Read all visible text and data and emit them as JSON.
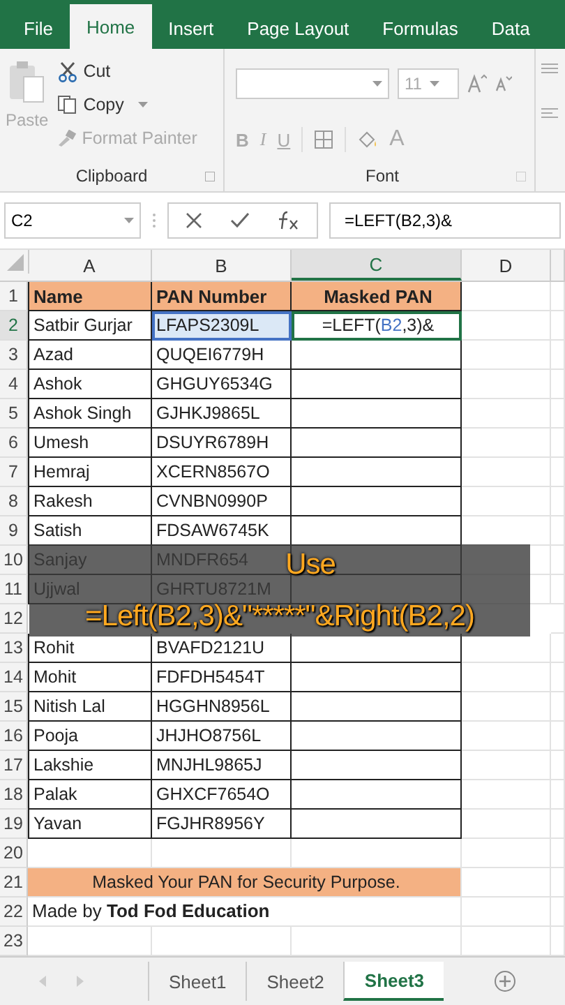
{
  "ribbon_tabs": [
    {
      "label": "File",
      "selected": false
    },
    {
      "label": "Home",
      "selected": true
    },
    {
      "label": "Insert",
      "selected": false
    },
    {
      "label": "Page Layout",
      "selected": false
    },
    {
      "label": "Formulas",
      "selected": false
    },
    {
      "label": "Data",
      "selected": false
    }
  ],
  "clipboard": {
    "paste": "Paste",
    "cut": "Cut",
    "copy": "Copy",
    "format_painter": "Format Painter",
    "group": "Clipboard"
  },
  "font": {
    "size": "11",
    "bold": "B",
    "italic": "I",
    "underline": "U",
    "font_color": "A",
    "group": "Font"
  },
  "formula_bar": {
    "name_box": "C2",
    "formula": "=LEFT(B2,3)&"
  },
  "columns": [
    "A",
    "B",
    "C",
    "D"
  ],
  "rows": [
    {
      "num": "1",
      "kind": "header",
      "cells": [
        "Name",
        "PAN Number",
        "Masked PAN"
      ]
    },
    {
      "num": "2",
      "kind": "data",
      "cells": [
        "Satbir Gurjar",
        "LFAPS2309L"
      ],
      "edit": {
        "before": "=LEFT(",
        "ref": "B2",
        "after": ",3)&"
      }
    },
    {
      "num": "3",
      "kind": "data",
      "cells": [
        "Azad",
        "QUQEI6779H"
      ]
    },
    {
      "num": "4",
      "kind": "data",
      "cells": [
        "Ashok",
        "GHGUY6534G"
      ]
    },
    {
      "num": "5",
      "kind": "data",
      "cells": [
        "Ashok Singh",
        "GJHKJ9865L"
      ]
    },
    {
      "num": "6",
      "kind": "data",
      "cells": [
        "Umesh",
        "DSUYR6789H"
      ]
    },
    {
      "num": "7",
      "kind": "data",
      "cells": [
        "Hemraj",
        "XCERN8567O"
      ]
    },
    {
      "num": "8",
      "kind": "data",
      "cells": [
        "Rakesh",
        "CVNBN0990P"
      ]
    },
    {
      "num": "9",
      "kind": "data",
      "cells": [
        "Satish",
        "FDSAW6745K"
      ]
    },
    {
      "num": "10",
      "kind": "data",
      "cells": [
        "Sanjay",
        "MNDFR654"
      ]
    },
    {
      "num": "11",
      "kind": "data",
      "cells": [
        "Ujjwal",
        "GHRTU8721M"
      ]
    },
    {
      "num": "12",
      "kind": "covered",
      "cells": []
    },
    {
      "num": "13",
      "kind": "data",
      "cells": [
        "Rohit",
        "BVAFD2121U"
      ]
    },
    {
      "num": "14",
      "kind": "data",
      "cells": [
        "Mohit",
        "FDFDH5454T"
      ]
    },
    {
      "num": "15",
      "kind": "data",
      "cells": [
        "Nitish Lal",
        "HGGHN8956L"
      ]
    },
    {
      "num": "16",
      "kind": "data",
      "cells": [
        "Pooja",
        "JHJHO8756L"
      ]
    },
    {
      "num": "17",
      "kind": "data",
      "cells": [
        "Lakshie",
        "MNJHL9865J"
      ]
    },
    {
      "num": "18",
      "kind": "data",
      "cells": [
        "Palak",
        "GHXCF7654O"
      ]
    },
    {
      "num": "19",
      "kind": "data",
      "cells": [
        "Yavan",
        "FGJHR8956Y"
      ]
    },
    {
      "num": "20",
      "kind": "blank",
      "cells": []
    },
    {
      "num": "21",
      "kind": "banner",
      "cells": [
        "Masked Your PAN for Security Purpose."
      ]
    },
    {
      "num": "22",
      "kind": "note",
      "cells": [
        "Made by **Tod Fod Education**"
      ]
    },
    {
      "num": "23",
      "kind": "blank",
      "cells": []
    }
  ],
  "caption": {
    "title": "Use",
    "formula": "=Left(B2,3)&\"*****\"&Right(B2,2)"
  },
  "sheet_tabs": [
    {
      "label": "Sheet1",
      "selected": false
    },
    {
      "label": "Sheet2",
      "selected": false
    },
    {
      "label": "Sheet3",
      "selected": true
    }
  ]
}
